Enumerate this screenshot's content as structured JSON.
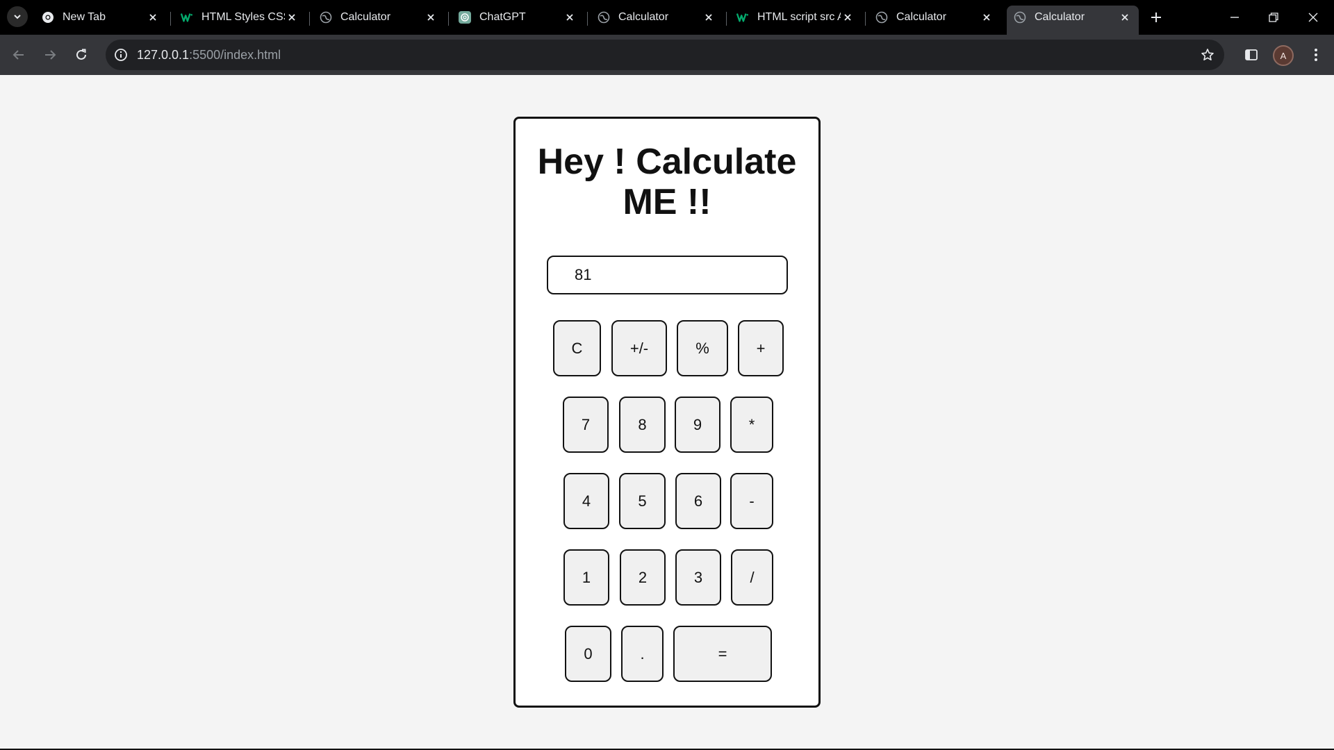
{
  "browser": {
    "tabs": [
      {
        "title": "New Tab",
        "favicon": "chrome-icon"
      },
      {
        "title": "HTML Styles CSS",
        "favicon": "w3schools-icon"
      },
      {
        "title": "Calculator",
        "favicon": "globe-icon"
      },
      {
        "title": "ChatGPT",
        "favicon": "chatgpt-icon"
      },
      {
        "title": "Calculator",
        "favicon": "globe-icon"
      },
      {
        "title": "HTML script src Attribute",
        "favicon": "w3schools-icon"
      },
      {
        "title": "Calculator",
        "favicon": "globe-icon"
      },
      {
        "title": "Calculator",
        "favicon": "globe-icon",
        "active": true
      }
    ],
    "address": {
      "host": "127.0.0.1",
      "rest": ":5500/index.html"
    },
    "profile_initial": "A"
  },
  "calculator": {
    "title": "Hey ! Calculate ME !!",
    "display_value": "81",
    "keys": [
      "C",
      "+/-",
      "%",
      "+",
      "7",
      "8",
      "9",
      "*",
      "4",
      "5",
      "6",
      "-",
      "1",
      "2",
      "3",
      "/",
      "0",
      ".",
      "="
    ]
  },
  "colors": {
    "tab_strip": "#000000",
    "toolbar": "#35363a",
    "page_background": "#f4f4f4",
    "key_background": "#f0f0f0",
    "w3schools_green": "#04aa6d"
  }
}
